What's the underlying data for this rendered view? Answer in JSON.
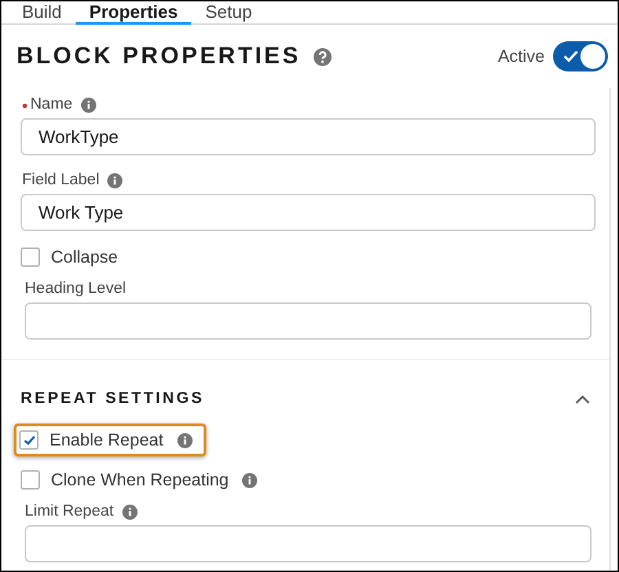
{
  "tabs": [
    {
      "label": "Build",
      "selected": false
    },
    {
      "label": "Properties",
      "selected": true
    },
    {
      "label": "Setup",
      "selected": false
    }
  ],
  "header": {
    "title": "BLOCK PROPERTIES",
    "help": true,
    "toggle": {
      "label": "Active",
      "on": true
    }
  },
  "fields": [
    {
      "kind": "text",
      "label": "Name",
      "required": true,
      "info": true,
      "inset": false,
      "value": "WorkType"
    },
    {
      "kind": "text",
      "label": "Field Label",
      "required": false,
      "info": true,
      "inset": false,
      "value": "Work Type"
    },
    {
      "kind": "checkbox",
      "label": "Collapse",
      "checked": false,
      "info": false,
      "highlighted": false
    },
    {
      "kind": "text",
      "label": "Heading Level",
      "required": false,
      "info": false,
      "inset": true
    }
  ],
  "section": {
    "title": "REPEAT SETTINGS",
    "expanded": true,
    "fields": [
      {
        "kind": "checkbox",
        "label": "Enable Repeat",
        "checked": true,
        "info": true,
        "highlighted": true
      },
      {
        "kind": "checkbox",
        "label": "Clone When Repeating",
        "checked": false,
        "info": true,
        "highlighted": false
      },
      {
        "kind": "text",
        "label": "Limit Repeat",
        "required": false,
        "info": true,
        "inset": true
      }
    ]
  }
}
